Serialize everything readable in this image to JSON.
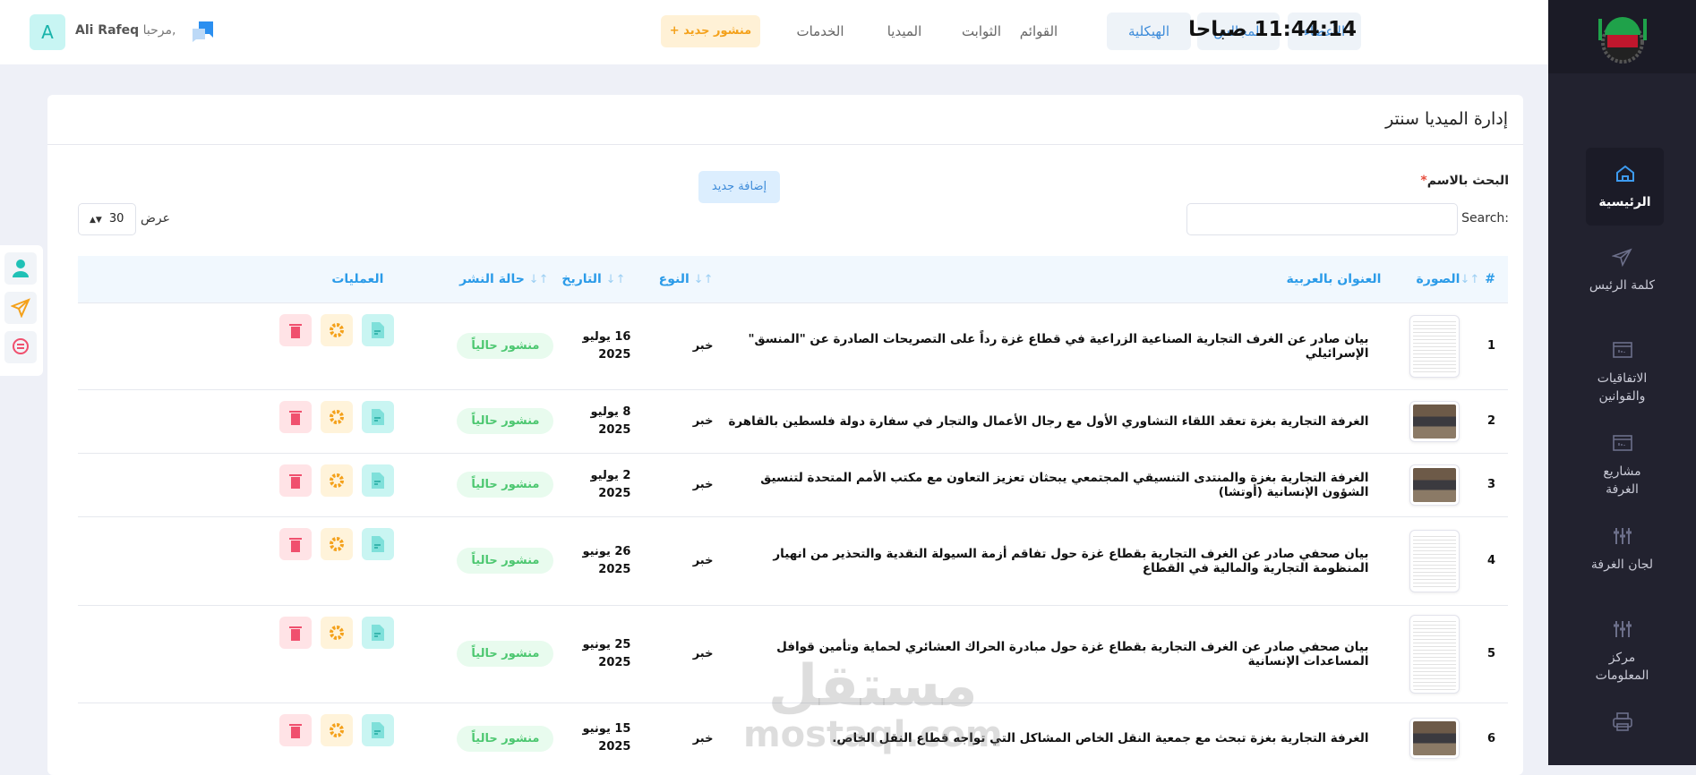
{
  "header": {
    "clock": "11:44:14 صباحا",
    "nav": [
      {
        "label": "الأعضاء",
        "hl": true
      },
      {
        "label": "المجالس",
        "hl": true
      },
      {
        "label": "الهيكلية",
        "hl": true
      },
      {
        "label": "القوائم"
      },
      {
        "label": "الثوابت"
      },
      {
        "label": "الميديا"
      },
      {
        "label": "الخدمات"
      }
    ],
    "new_post": "منشور جديد +",
    "greeting": "مرحبا,",
    "user": "Ali Rafeq",
    "avatar": "A"
  },
  "sidebar": {
    "logo_text": "G.C.C.I",
    "items": [
      {
        "label": "الرئيسية",
        "icon": "home-icon"
      },
      {
        "label": "كلمة الرئيس",
        "icon": "send-icon"
      },
      {
        "label": "الاتفاقيات والقوانين",
        "icon": "browser-icon"
      },
      {
        "label": "مشاريع الغرفة",
        "icon": "browser-icon"
      },
      {
        "label": "لجان الغرفة",
        "icon": "sliders-icon"
      },
      {
        "label": "مركز المعلومات",
        "icon": "sliders-icon"
      },
      {
        "label": "",
        "icon": "printer-icon"
      }
    ]
  },
  "page": {
    "title": "إدارة الميديا سنتر",
    "search_name_label": "البحث بالاسم",
    "required": "*",
    "search_label": "Search:",
    "add_new": "إضافة جديد",
    "show_label": "عرض",
    "show_value": "30"
  },
  "table": {
    "headers": {
      "num": "#",
      "image": "الصورة",
      "title": "العنوان بالعربية",
      "type": "النوع",
      "date": "التاريخ",
      "status": "حالة النشر",
      "actions": "العمليات"
    },
    "rows": [
      {
        "num": "1",
        "img": "doc",
        "title": "بيان صادر عن الغرف التجارية الصناعية الزراعية في قطاع غزة رداً على التصريحات الصادرة عن \"المنسق\" الإسرائيلي",
        "type": "خبر",
        "date1": "16 يوليو",
        "date2": "2025",
        "status": "منشور حالياً"
      },
      {
        "num": "2",
        "img": "photo",
        "title": "الغرفة التجارية بغزة تعقد اللقاء التشاوري الأول مع رجال الأعمال والتجار في سفارة دولة فلسطين بالقاهرة",
        "type": "خبر",
        "date1": "8 يوليو",
        "date2": "2025",
        "status": "منشور حالياً"
      },
      {
        "num": "3",
        "img": "photo",
        "title": "الغرفة التجارية بغزة والمنتدى التنسيقي المجتمعي يبحثان تعزيز التعاون مع مكتب الأمم المتحدة لتنسيق الشؤون الإنسانية (أوتشا)",
        "type": "خبر",
        "date1": "2 يوليو",
        "date2": "2025",
        "status": "منشور حالياً"
      },
      {
        "num": "4",
        "img": "doc",
        "title": "بيان صحفي صادر عن الغرف التجارية بقطاع غزة حول تفاقم أزمة السيولة النقدية والتحذير من انهيار المنظومة التجارية والمالية في القطاع",
        "type": "خبر",
        "date1": "26 يونيو",
        "date2": "2025",
        "status": "منشور حالياً"
      },
      {
        "num": "5",
        "img": "doc",
        "title": "بيان صحفي صادر عن الغرف التجارية بقطاع غزة حول مبادرة الحراك العشائري لحماية وتأمين قوافل المساعدات الإنسانية",
        "type": "خبر",
        "date1": "25 يونيو",
        "date2": "2025",
        "status": "منشور حالياً"
      },
      {
        "num": "6",
        "img": "photo",
        "title": "الغرفة التجارية بغزة تبحث مع جمعية النقل الخاص المشاكل التي تواجه قطاع النقل الخاص.",
        "type": "خبر",
        "date1": "15 يونيو",
        "date2": "2025",
        "status": "منشور حالياً"
      }
    ]
  },
  "watermark": {
    "ar": "مستقل",
    "en": "mostaql.com"
  },
  "colors": {
    "accent": "#2b9be8",
    "sidebar": "#22222f",
    "status": "#4cc770",
    "danger": "#f0506e",
    "warning": "#f4a11b",
    "info": "#20c1b6"
  }
}
